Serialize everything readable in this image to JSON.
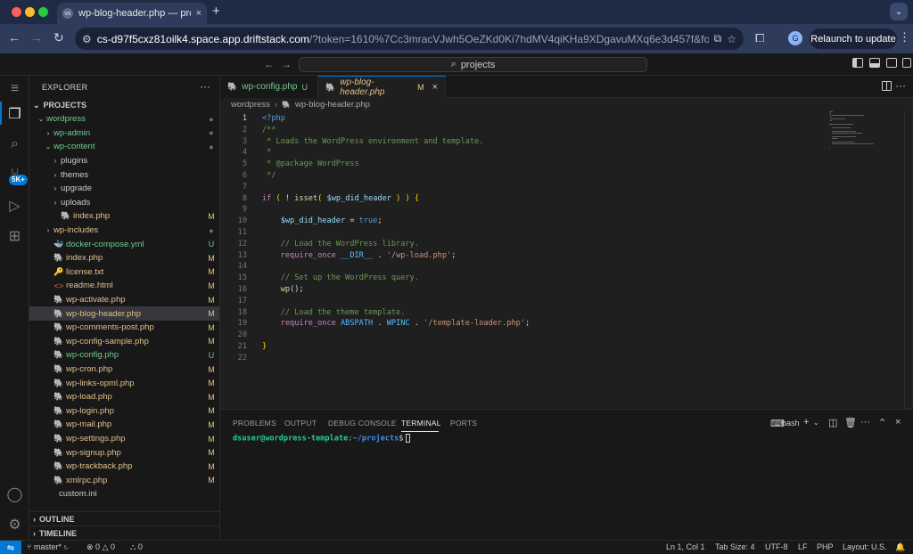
{
  "browser": {
    "tab_title": "wp-blog-header.php — projects",
    "tab_favicon": "vs",
    "close_glyph": "×",
    "new_tab_glyph": "+",
    "url_host": "cs-d97f5cxz81oilk4.space.app.driftstack.com",
    "url_rest": "/?token=1610%7Cc3mracVJwh5OeZKd0Ki7hdMV4qiKHa9XDgavuMXq6e3d457f&folder=/hom...",
    "avatar_letter": "G",
    "relaunch_label": "Relaunch to update",
    "colors": {
      "tabstrip": "#1f2a44",
      "toolbar": "#2f3b5a"
    }
  },
  "vscode": {
    "command_center": "projects",
    "sidebar": {
      "title": "EXPLORER",
      "more": "···",
      "section_projects": "PROJECTS",
      "section_outline": "OUTLINE",
      "section_timeline": "TIMELINE",
      "tree": [
        {
          "label": "wordpress",
          "type": "folder-open",
          "depth": 1,
          "status": "●",
          "status_kind": "dot",
          "color": "unt"
        },
        {
          "label": "wp-admin",
          "type": "folder",
          "depth": 2,
          "status": "●",
          "status_kind": "dot",
          "color": "unt"
        },
        {
          "label": "wp-content",
          "type": "folder-open",
          "depth": 2,
          "status": "●",
          "status_kind": "dot",
          "color": "unt"
        },
        {
          "label": "plugins",
          "type": "folder",
          "depth": 3,
          "status": "",
          "status_kind": "",
          "color": "plain"
        },
        {
          "label": "themes",
          "type": "folder",
          "depth": 3,
          "status": "",
          "status_kind": "",
          "color": "plain"
        },
        {
          "label": "upgrade",
          "type": "folder",
          "depth": 3,
          "status": "",
          "status_kind": "",
          "color": "plain"
        },
        {
          "label": "uploads",
          "type": "folder",
          "depth": 3,
          "status": "",
          "status_kind": "",
          "color": "plain"
        },
        {
          "label": "index.php",
          "type": "php",
          "depth": 3,
          "status": "M",
          "status_kind": "mod",
          "color": "mod"
        },
        {
          "label": "wp-includes",
          "type": "folder",
          "depth": 2,
          "status": "●",
          "status_kind": "dot",
          "color": "mod"
        },
        {
          "label": "docker-compose.yml",
          "type": "docker",
          "depth": 2,
          "status": "U",
          "status_kind": "unt",
          "color": "unt"
        },
        {
          "label": "index.php",
          "type": "php",
          "depth": 2,
          "status": "M",
          "status_kind": "mod",
          "color": "mod"
        },
        {
          "label": "license.txt",
          "type": "txt",
          "depth": 2,
          "status": "M",
          "status_kind": "mod",
          "color": "mod"
        },
        {
          "label": "readme.html",
          "type": "html",
          "depth": 2,
          "status": "M",
          "status_kind": "mod",
          "color": "mod"
        },
        {
          "label": "wp-activate.php",
          "type": "php",
          "depth": 2,
          "status": "M",
          "status_kind": "mod",
          "color": "mod"
        },
        {
          "label": "wp-blog-header.php",
          "type": "php",
          "depth": 2,
          "status": "M",
          "status_kind": "mod",
          "color": "mod",
          "selected": true
        },
        {
          "label": "wp-comments-post.php",
          "type": "php",
          "depth": 2,
          "status": "M",
          "status_kind": "mod",
          "color": "mod"
        },
        {
          "label": "wp-config-sample.php",
          "type": "php",
          "depth": 2,
          "status": "M",
          "status_kind": "mod",
          "color": "mod"
        },
        {
          "label": "wp-config.php",
          "type": "php",
          "depth": 2,
          "status": "U",
          "status_kind": "unt",
          "color": "unt"
        },
        {
          "label": "wp-cron.php",
          "type": "php",
          "depth": 2,
          "status": "M",
          "status_kind": "mod",
          "color": "mod"
        },
        {
          "label": "wp-links-opml.php",
          "type": "php",
          "depth": 2,
          "status": "M",
          "status_kind": "mod",
          "color": "mod"
        },
        {
          "label": "wp-load.php",
          "type": "php",
          "depth": 2,
          "status": "M",
          "status_kind": "mod",
          "color": "mod"
        },
        {
          "label": "wp-login.php",
          "type": "php",
          "depth": 2,
          "status": "M",
          "status_kind": "mod",
          "color": "mod"
        },
        {
          "label": "wp-mail.php",
          "type": "php",
          "depth": 2,
          "status": "M",
          "status_kind": "mod",
          "color": "mod"
        },
        {
          "label": "wp-settings.php",
          "type": "php",
          "depth": 2,
          "status": "M",
          "status_kind": "mod",
          "color": "mod"
        },
        {
          "label": "wp-signup.php",
          "type": "php",
          "depth": 2,
          "status": "M",
          "status_kind": "mod",
          "color": "mod"
        },
        {
          "label": "wp-trackback.php",
          "type": "php",
          "depth": 2,
          "status": "M",
          "status_kind": "mod",
          "color": "mod"
        },
        {
          "label": "xmlrpc.php",
          "type": "php",
          "depth": 2,
          "status": "M",
          "status_kind": "mod",
          "color": "mod"
        },
        {
          "label": "custom.ini",
          "type": "ini",
          "depth": 1,
          "status": "",
          "status_kind": "",
          "color": "plain"
        }
      ]
    },
    "editor": {
      "tabs": [
        {
          "name": "wp-config.php",
          "flag": "U",
          "active": false
        },
        {
          "name": "wp-blog-header.php",
          "flag": "M",
          "active": true
        }
      ],
      "tab_close": "×",
      "breadcrumb": [
        "wordpress",
        "wp-blog-header.php"
      ],
      "current_line": 1,
      "lines": [
        [
          [
            "tag",
            "<?php"
          ]
        ],
        [
          [
            "com",
            "/**"
          ]
        ],
        [
          [
            "com",
            " * Loads the WordPress environment and template."
          ]
        ],
        [
          [
            "com",
            " *"
          ]
        ],
        [
          [
            "com",
            " * @package WordPress"
          ]
        ],
        [
          [
            "com",
            " */"
          ]
        ],
        [],
        [
          [
            "ctrl",
            "if"
          ],
          [
            "pl",
            " "
          ],
          [
            "br",
            "("
          ],
          [
            "pl",
            " ! "
          ],
          [
            "fn",
            "isset"
          ],
          [
            "br",
            "("
          ],
          [
            "pl",
            " "
          ],
          [
            "var",
            "$wp_did_header"
          ],
          [
            "pl",
            " "
          ],
          [
            "br",
            ")"
          ],
          [
            "pl",
            " "
          ],
          [
            "br",
            ")"
          ],
          [
            "pl",
            " "
          ],
          [
            "br",
            "{"
          ]
        ],
        [],
        [
          [
            "pl",
            "    "
          ],
          [
            "var",
            "$wp_did_header"
          ],
          [
            "pl",
            " = "
          ],
          [
            "kw",
            "true"
          ],
          [
            "pl",
            ";"
          ]
        ],
        [],
        [
          [
            "com",
            "    // Load the WordPress library."
          ]
        ],
        [
          [
            "pl",
            "    "
          ],
          [
            "ctrl",
            "require_once"
          ],
          [
            "pl",
            " "
          ],
          [
            "const",
            "__DIR__"
          ],
          [
            "pl",
            " . "
          ],
          [
            "str",
            "'/wp-load.php'"
          ],
          [
            "pl",
            ";"
          ]
        ],
        [],
        [
          [
            "com",
            "    // Set up the WordPress query."
          ]
        ],
        [
          [
            "pl",
            "    "
          ],
          [
            "fn",
            "wp"
          ],
          [
            "pl",
            "();"
          ]
        ],
        [],
        [
          [
            "com",
            "    // Load the theme template."
          ]
        ],
        [
          [
            "pl",
            "    "
          ],
          [
            "ctrl",
            "require_once"
          ],
          [
            "pl",
            " "
          ],
          [
            "const",
            "ABSPATH"
          ],
          [
            "pl",
            " . "
          ],
          [
            "const",
            "WPINC"
          ],
          [
            "pl",
            " . "
          ],
          [
            "str",
            "'/template-loader.php'"
          ],
          [
            "pl",
            ";"
          ]
        ],
        [],
        [
          [
            "br",
            "}"
          ]
        ],
        []
      ]
    },
    "panel": {
      "tabs": [
        "PROBLEMS",
        "OUTPUT",
        "DEBUG CONSOLE",
        "TERMINAL",
        "PORTS"
      ],
      "active_tab": "TERMINAL",
      "shell": "bash",
      "terminal_user": "dsuser@wordpress-template",
      "terminal_colon": ":",
      "terminal_path": "~/projects",
      "terminal_dollar": "$"
    },
    "statusbar": {
      "branch": "master*",
      "errors": "0",
      "warnings": "0",
      "ports": "0",
      "position": "Ln 1, Col 1",
      "tab_size": "Tab Size: 4",
      "encoding": "UTF-8",
      "eol": "LF",
      "language": "PHP",
      "layout": "Layout: U.S."
    },
    "activity_badge": "5K+"
  }
}
